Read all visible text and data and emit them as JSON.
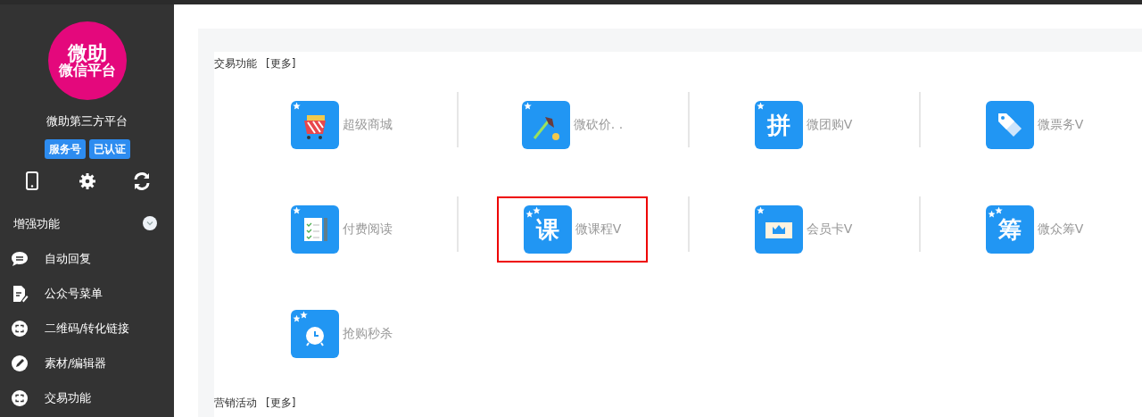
{
  "sidebar": {
    "logo": {
      "line_1": "微助",
      "line_2": "微信平台"
    },
    "account_name": "微助第三方平台",
    "badges": [
      "服务号",
      "已认证"
    ],
    "tools": [
      {
        "kind": "phone"
      },
      {
        "kind": "gear"
      },
      {
        "kind": "refresh"
      }
    ],
    "section_label": "增强功能",
    "menu": [
      {
        "label": "自动回复",
        "kind": "chat"
      },
      {
        "label": "公众号菜单",
        "kind": "doc"
      },
      {
        "label": "二维码/转化链接",
        "kind": "link"
      },
      {
        "label": "素材/编辑器",
        "kind": "pencil"
      },
      {
        "label": "交易功能",
        "kind": "link"
      }
    ]
  },
  "sections": [
    {
      "title": "交易功能",
      "more": "[更多]",
      "items": [
        {
          "label": "超级商城",
          "kind": "cart",
          "badge": {
            "kind": "star"
          },
          "selected": false
        },
        {
          "label": "微砍价. .",
          "kind": "axe",
          "badge": {
            "kind": "star"
          },
          "selected": false
        },
        {
          "label": "微团购V",
          "kind": "glyph",
          "glyph": "拼",
          "badge": {
            "kind": "star"
          },
          "selected": false
        },
        {
          "label": "微票务V",
          "kind": "tag",
          "selected": false
        },
        {
          "label": "付费阅读",
          "kind": "doc",
          "badge": {
            "kind": "star"
          },
          "selected": false
        },
        {
          "label": "微课程V",
          "kind": "glyph",
          "glyph": "课",
          "badge": {
            "kind": "double"
          },
          "selected": true
        },
        {
          "label": "会员卡V",
          "kind": "card",
          "badge": {
            "kind": "star"
          },
          "selected": false
        },
        {
          "label": "微众筹V",
          "kind": "glyph",
          "glyph": "筹",
          "badge": {
            "kind": "double"
          },
          "selected": false
        },
        {
          "label": "抢购秒杀",
          "kind": "clock",
          "badge": {
            "kind": "double"
          },
          "selected": false
        }
      ]
    },
    {
      "title": "营销活动",
      "more": "[更多]"
    }
  ]
}
